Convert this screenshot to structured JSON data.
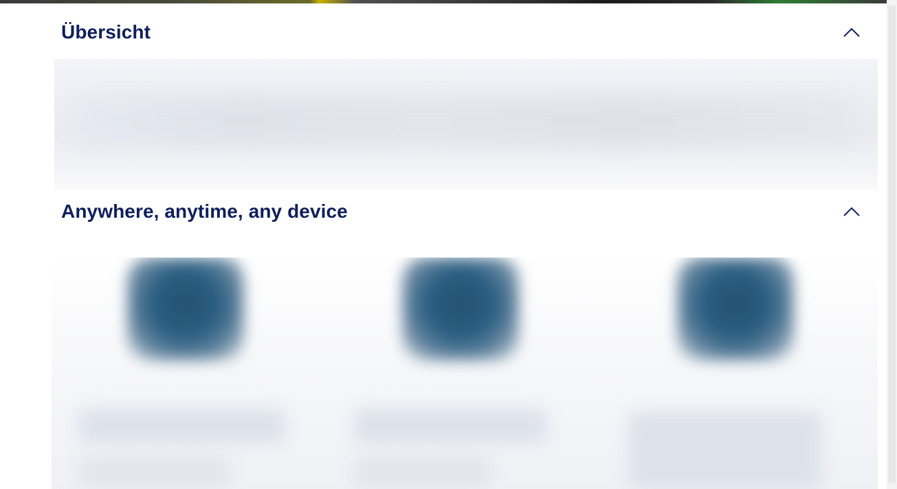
{
  "sections": {
    "overview": {
      "title": "Übersicht",
      "expanded": true
    },
    "devices": {
      "title": "Anywhere, anytime, any device",
      "expanded": true
    }
  },
  "icons": {
    "collapse": "chevron-up-icon"
  },
  "colors": {
    "heading": "#0f1f5c",
    "background": "#ffffff"
  }
}
